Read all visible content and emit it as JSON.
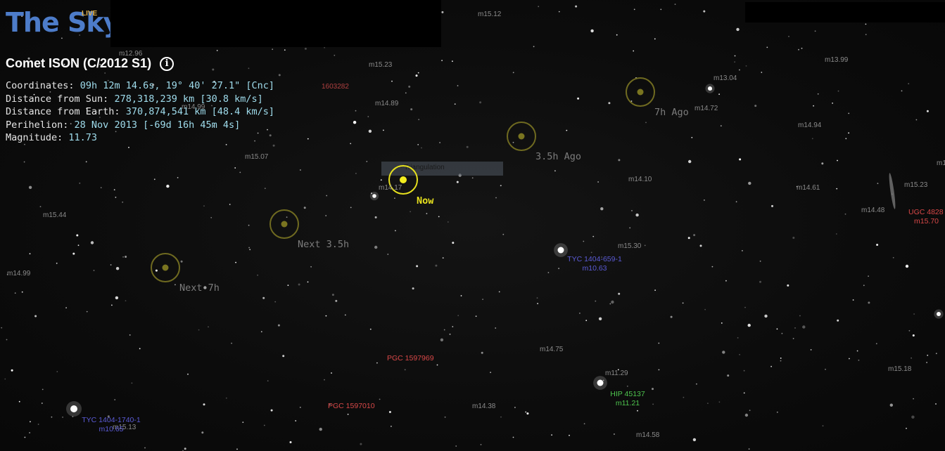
{
  "logo": {
    "text": "The Sky",
    "badge": "LIVE"
  },
  "info": {
    "title": "Comet ISON (C/2012 S1)",
    "info_icon": "info-circle-icon",
    "coordinates_label": "Coordinates:",
    "coordinates_value": "09h 12m 14.6s, 19° 40' 27.1\" [Cnc]",
    "sun_label": "Distance from Sun:",
    "sun_value": "278,318,239 km [30.8 km/s]",
    "earth_label": "Distance from Earth:",
    "earth_value": "370,874,541 km [48.4 km/s]",
    "perihelion_label": "Perihelion:",
    "perihelion_value": "28 Nov 2013 [-69d 16h 45m 4s]",
    "magnitude_label": "Magnitude:",
    "magnitude_value": "11.73"
  },
  "tooltip": {
    "text": "·· Triangulation"
  },
  "track": {
    "seven_ago": "7h Ago",
    "three_ago": "3.5h Ago",
    "now": "Now",
    "next_three": "Next 3.5h",
    "next_seven": "Next 7h"
  },
  "magnitudes": {
    "m1": "m15.12",
    "m2": "m12.96",
    "m3": "m15.23",
    "m4": "m14.89",
    "m5": "m13.04",
    "m6": "m14.72",
    "m7": "m13.99",
    "m8": "m14.94",
    "m9": "m15.07",
    "m10": "m14.17",
    "m11": "m14.10",
    "m12": "m14.61",
    "m13": "m15.23",
    "m14": "m14.48",
    "m15": "m15.44",
    "m16": "m15.30",
    "m17": "m14.99",
    "m18": "m14.75",
    "m19": "m11.29",
    "m20": "m15.18",
    "m21": "m14.38",
    "m22": "m14.58",
    "m23": "m15.13",
    "m24": "m1",
    "m25": "m14.99",
    "m26": "1603282"
  },
  "objects": {
    "ugc_name": "UGC 4828",
    "ugc_mag": "m15.70",
    "tyc1_name": "TYC 1404-659-1",
    "tyc1_mag": "m10.63",
    "pgc1": "PGC 1597969",
    "pgc2": "PGC 1597010",
    "hip_name": "HIP 45137",
    "hip_mag": "m11.21",
    "tyc2_name": "TYC 1404-1740-1",
    "tyc2_mag": "m10.65"
  },
  "colors": {
    "background": "#0b0b0b",
    "logo_blue": "#4d7cc9",
    "value_cyan": "#9fdcec",
    "now_yellow": "#e6e01e",
    "track_olive": "#6f6a20",
    "galaxy_red": "#d94848",
    "star_blue": "#5b5bd6",
    "hip_green": "#4ec54e"
  }
}
